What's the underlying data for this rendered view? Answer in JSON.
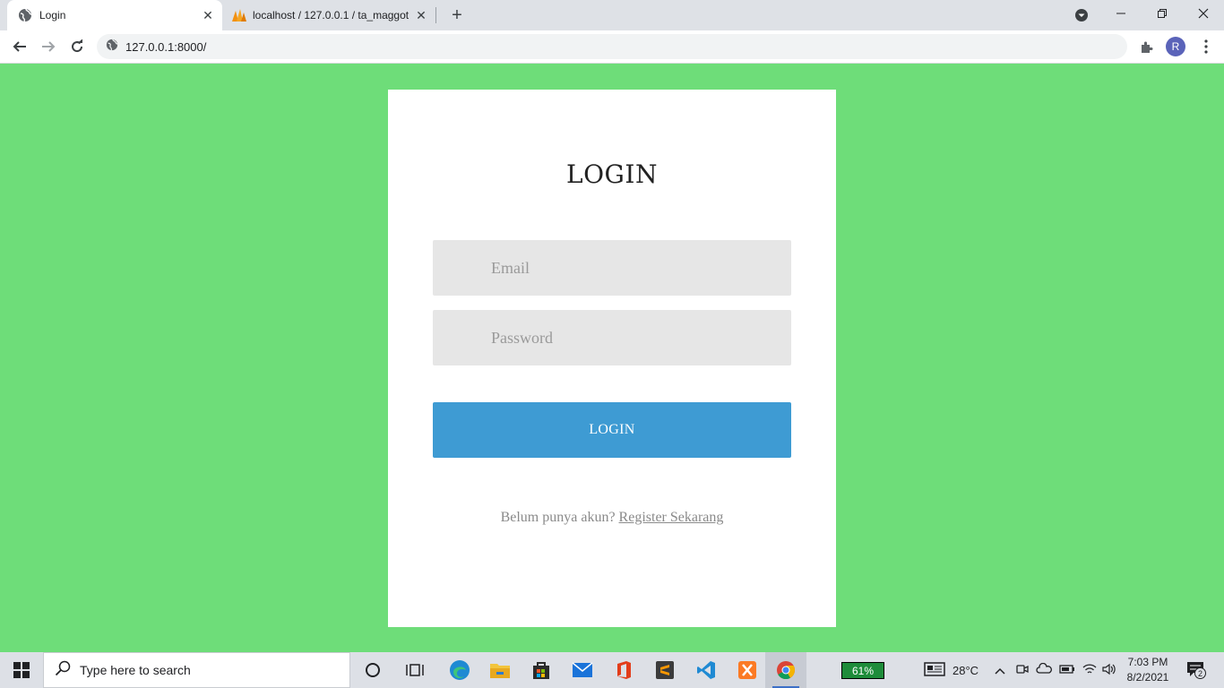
{
  "browser": {
    "tabs": [
      {
        "title": "Login",
        "active": true,
        "favicon": "globe-icon"
      },
      {
        "title": "localhost / 127.0.0.1 / ta_maggot",
        "active": false,
        "favicon": "phpmyadmin-icon"
      }
    ],
    "new_tab_label": "+",
    "address": "127.0.0.1:8000/",
    "profile_initial": "R"
  },
  "page": {
    "title": "LOGIN",
    "email_placeholder": "Email",
    "password_placeholder": "Password",
    "login_button": "LOGIN",
    "register_prompt": "Belum punya akun?",
    "register_link": "Register Sekarang",
    "background_color": "#6edd79",
    "button_color": "#3e9bd3"
  },
  "taskbar": {
    "search_placeholder": "Type here to search",
    "battery": "61%",
    "weather": "28°C",
    "time": "7:03 PM",
    "date": "8/2/2021",
    "notification_count": "2",
    "apps": [
      "cortana-icon",
      "task-view-icon",
      "edge-icon",
      "file-explorer-icon",
      "store-icon",
      "mail-icon",
      "office-icon",
      "sublime-text-icon",
      "vscode-icon",
      "xampp-icon",
      "chrome-icon"
    ]
  }
}
